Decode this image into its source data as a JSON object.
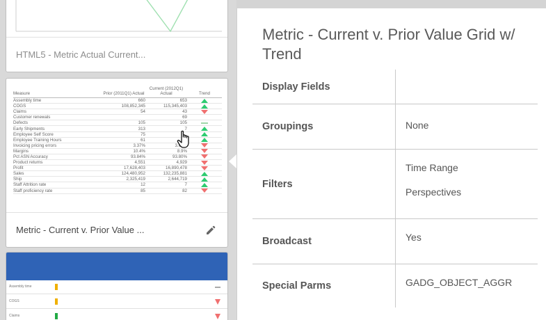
{
  "gallery": {
    "cards": [
      {
        "caption": "HTML5 - Metric Actual Current..."
      },
      {
        "caption": "Metric - Current v. Prior Value ...",
        "preview": {
          "headers": [
            "Measure",
            "Prior (2011Q1) Actual",
            "Current (2012Q1) Actual",
            "Trend"
          ],
          "rows": [
            {
              "measure": "Assembly time",
              "prior": "660",
              "current": "653",
              "trend": "up"
            },
            {
              "measure": "COGS",
              "prior": "108,852,345",
              "current": "115,345,403",
              "trend": "up"
            },
            {
              "measure": "Claims",
              "prior": "54",
              "current": "43",
              "trend": "down"
            },
            {
              "measure": "Customer renewals",
              "prior": "",
              "current": "69",
              "trend": "none"
            },
            {
              "measure": "Defects",
              "prior": "105",
              "current": "105",
              "trend": "flat"
            },
            {
              "measure": "Early Shipments",
              "prior": "313",
              "current": "7",
              "trend": "up"
            },
            {
              "measure": "Employee Self Score",
              "prior": "75",
              "current": "",
              "trend": "up"
            },
            {
              "measure": "Employee Training Hours",
              "prior": "61",
              "current": "",
              "trend": "up"
            },
            {
              "measure": "Invoicing pricing errors",
              "prior": "3.37%",
              "current": "3.67%",
              "trend": "down"
            },
            {
              "measure": "Margins",
              "prior": "10.4%",
              "current": "8.9%",
              "trend": "down"
            },
            {
              "measure": "Pct ASN Accuracy",
              "prior": "93.84%",
              "current": "93.80%",
              "trend": "down"
            },
            {
              "measure": "Product returns",
              "prior": "4,551",
              "current": "4,929",
              "trend": "down"
            },
            {
              "measure": "Profit",
              "prior": "17,628,403",
              "current": "16,890,478",
              "trend": "down"
            },
            {
              "measure": "Sales",
              "prior": "124,480,952",
              "current": "132,235,881",
              "trend": "up"
            },
            {
              "measure": "Ship",
              "prior": "2,325,419",
              "current": "2,644,719",
              "trend": "up"
            },
            {
              "measure": "Staff Attrition rate",
              "prior": "12",
              "current": "7",
              "trend": "up"
            },
            {
              "measure": "Staff proficiency rate",
              "prior": "85",
              "current": "82",
              "trend": "down"
            }
          ]
        }
      },
      {
        "preview": {
          "rows": [
            "Assembly time",
            "COGS",
            "Claims"
          ]
        }
      }
    ]
  },
  "panel": {
    "title": "Metric - Current v. Prior Value Grid w/ Trend",
    "properties": [
      {
        "key": "Display Fields",
        "values": []
      },
      {
        "key": "Groupings",
        "values": [
          "None"
        ]
      },
      {
        "key": "Filters",
        "values": [
          "Time Range",
          "Perspectives"
        ]
      },
      {
        "key": "Broadcast",
        "values": [
          "Yes"
        ]
      },
      {
        "key": "Special Parms",
        "values": [
          "GADG_OBJECT_AGGR"
        ]
      }
    ]
  },
  "icons": {
    "edit": "pencil-icon",
    "pointer": "hand-cursor-icon"
  },
  "colors": {
    "trend_up": "#2ecc71",
    "trend_down": "#f07070",
    "grid_header": "#2f63b6"
  }
}
